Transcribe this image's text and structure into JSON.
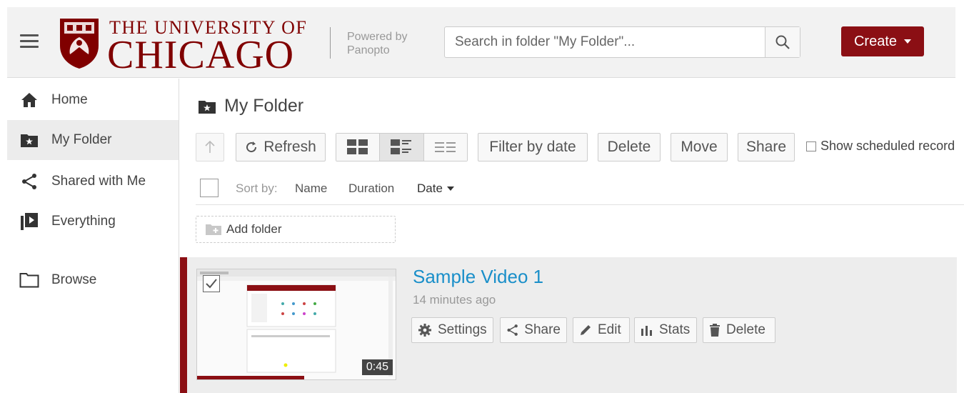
{
  "header": {
    "brand_top": "THE UNIVERSITY OF",
    "brand_bottom": "CHICAGO",
    "powered_by": "Powered by\nPanopto",
    "search_placeholder": "Search in folder \"My Folder\"...",
    "create_label": "Create"
  },
  "sidebar": {
    "items": [
      {
        "label": "Home",
        "icon": "home-icon"
      },
      {
        "label": "My Folder",
        "icon": "folder-star-icon",
        "active": true
      },
      {
        "label": "Shared with Me",
        "icon": "share-icon"
      },
      {
        "label": "Everything",
        "icon": "video-library-icon"
      },
      {
        "label": "Browse",
        "icon": "folder-icon"
      }
    ]
  },
  "main": {
    "folder_title": "My Folder",
    "toolbar": {
      "refresh": "Refresh",
      "filter": "Filter by date",
      "delete": "Delete",
      "move": "Move",
      "share": "Share",
      "show_scheduled": "Show scheduled record"
    },
    "sort": {
      "label": "Sort by:",
      "name": "Name",
      "duration": "Duration",
      "date": "Date"
    },
    "add_folder": "Add folder",
    "session": {
      "title": "Sample Video 1",
      "time": "14 minutes ago",
      "duration": "0:45",
      "progress_fraction": 0.54,
      "actions": {
        "settings": "Settings",
        "share": "Share",
        "edit": "Edit",
        "stats": "Stats",
        "delete": "Delete"
      }
    }
  },
  "colors": {
    "brand_maroon": "#800000",
    "create_button": "#8b0f14",
    "link_blue": "#1a8fc9"
  }
}
